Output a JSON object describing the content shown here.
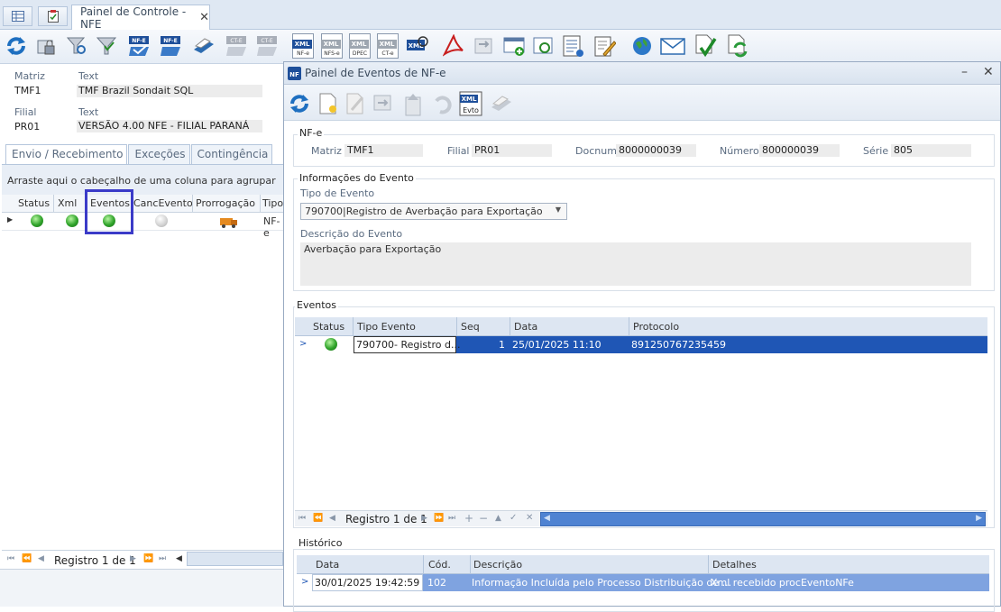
{
  "tabs": {
    "main_tab_label": "Painel de Controle - NFE"
  },
  "toolbar": {
    "buttons": [
      {
        "icon": "refresh-icon"
      },
      {
        "icon": "lock-icon"
      },
      {
        "icon": "filter-search-icon"
      },
      {
        "icon": "filter-icon"
      },
      {
        "icon": "nfe-check-icon"
      },
      {
        "icon": "nfe-send-icon"
      },
      {
        "icon": "printer-icon"
      },
      {
        "icon": "cte-disabled-icon"
      },
      {
        "icon": "cte-disabled-icon"
      }
    ],
    "doc_buttons": [
      {
        "tag": "XML",
        "sub": "NF-e",
        "enabled": true
      },
      {
        "tag": "XML",
        "sub": "NFS-e",
        "enabled": false
      },
      {
        "tag": "XML",
        "sub": "DPEC",
        "enabled": false
      },
      {
        "tag": "XML",
        "sub": "CT-e",
        "enabled": false
      }
    ],
    "xml_search_label": "XML"
  },
  "left": {
    "matriz_label": "Matriz",
    "matriz_text_label": "Text",
    "matriz_code": "TMF1",
    "matriz_name": "TMF Brazil Sondait SQL",
    "filial_label": "Filial",
    "filial_text_label": "Text",
    "filial_code": "PR01",
    "filial_name": "VERSÃO  4.00 NFE - FILIAL PARANÁ",
    "tabs": [
      "Envio / Recebimento",
      "Exceções",
      "Contingência"
    ],
    "group_hint": "Arraste aqui o cabeçalho de uma coluna para agrupar",
    "columns": [
      "Status",
      "Xml",
      "Eventos",
      "CancEvento",
      "Prorrogação",
      "Tipo"
    ],
    "row": {
      "tipo": "NF-e"
    },
    "nav_text": "Registro 1 de 1"
  },
  "modal": {
    "title": "Painel de Eventos de NF-e",
    "evto_label": "Evto",
    "nfe_group": "NF-e",
    "matriz_label": "Matriz",
    "matriz": "TMF1",
    "filial_label": "Filial",
    "filial": "PR01",
    "docnum_label": "Docnum",
    "docnum": "8000000039",
    "numero_label": "Número",
    "numero": "800000039",
    "serie_label": "Série",
    "serie": "805",
    "info_group": "Informações do Evento",
    "tipo_label": "Tipo de Evento",
    "tipo_value": "790700|Registro de Averbação para Exportação",
    "desc_label": "Descrição do Evento",
    "desc_value": "Averbação para Exportação",
    "eventos_group": "Eventos",
    "eventos_columns": [
      "Status",
      "Tipo Evento",
      "Seq",
      "Data",
      "Protocolo"
    ],
    "eventos_row": {
      "tipo": "790700- Registro d...",
      "seq": "1",
      "data": "25/01/2025 11:10",
      "protocolo": "891250767235459"
    },
    "eventos_nav": "Registro 1 de 1",
    "historico_group": "Histórico",
    "hist_columns": [
      "Data",
      "Cód.",
      "Descrição",
      "Detalhes"
    ],
    "hist_row": {
      "data": "30/01/2025 19:42:59",
      "cod": "102",
      "descricao": "Informação Incluída pelo Processo Distribuição de ...",
      "detalhes": "Xml recebido procEventoNFe"
    }
  },
  "colors": {
    "accent": "#1f56b5",
    "highlight_box": "#3b3bc8",
    "history_row": "#7fa3e0"
  }
}
